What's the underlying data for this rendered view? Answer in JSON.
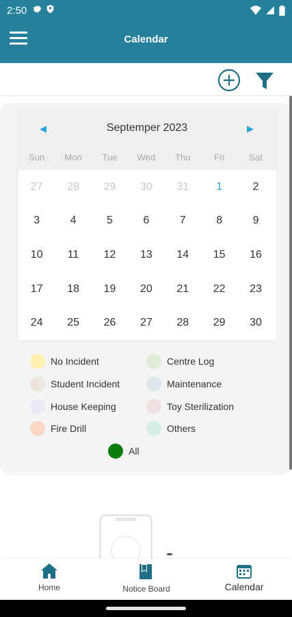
{
  "status": {
    "time": "2:50"
  },
  "app": {
    "title": "Calendar"
  },
  "calendar": {
    "month_label": "Septemper 2023",
    "weekdays": [
      "Sun",
      "Mon",
      "Tue",
      "Wed",
      "Thu",
      "Fri",
      "Sat"
    ],
    "days": [
      {
        "label": "27",
        "muted": true
      },
      {
        "label": "28",
        "muted": true
      },
      {
        "label": "29",
        "muted": true
      },
      {
        "label": "30",
        "muted": true
      },
      {
        "label": "31",
        "muted": true
      },
      {
        "label": "1",
        "selected": true
      },
      {
        "label": "2"
      },
      {
        "label": "3"
      },
      {
        "label": "4"
      },
      {
        "label": "5"
      },
      {
        "label": "6"
      },
      {
        "label": "7"
      },
      {
        "label": "8"
      },
      {
        "label": "9"
      },
      {
        "label": "10"
      },
      {
        "label": "11"
      },
      {
        "label": "12"
      },
      {
        "label": "13"
      },
      {
        "label": "14"
      },
      {
        "label": "15"
      },
      {
        "label": "16"
      },
      {
        "label": "17"
      },
      {
        "label": "18"
      },
      {
        "label": "19"
      },
      {
        "label": "20"
      },
      {
        "label": "21"
      },
      {
        "label": "22"
      },
      {
        "label": "23"
      },
      {
        "label": "24"
      },
      {
        "label": "25"
      },
      {
        "label": "26"
      },
      {
        "label": "27"
      },
      {
        "label": "28"
      },
      {
        "label": "29"
      },
      {
        "label": "30"
      }
    ]
  },
  "legend": [
    {
      "label": "No Incident",
      "color": "#fdefae"
    },
    {
      "label": "Centre Log",
      "color": "#e0ecd6"
    },
    {
      "label": "Student Incident",
      "color": "#ece6dc"
    },
    {
      "label": "Maintenance",
      "color": "#dce6ea"
    },
    {
      "label": "House Keeping",
      "color": "#eaeaf6"
    },
    {
      "label": "Toy Sterilization",
      "color": "#f1e0e0"
    },
    {
      "label": "Fire Drill",
      "color": "#fbd6c4"
    },
    {
      "label": "Others",
      "color": "#d6efe6"
    }
  ],
  "legend_all": {
    "label": "All",
    "color": "#0a7d0a"
  },
  "nav": {
    "home": "Home",
    "notice": "Notice Board",
    "calendar": "Calendar"
  },
  "colors": {
    "brand": "#25809b",
    "accent": "#27a7d6"
  }
}
